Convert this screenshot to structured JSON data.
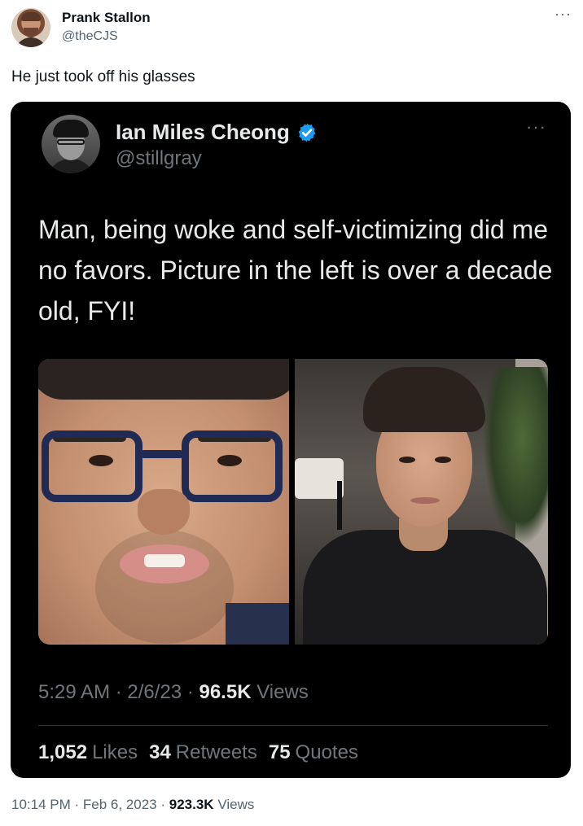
{
  "outer_tweet": {
    "author_name": "Prank Stallon",
    "author_handle": "@theCJS",
    "text": "He just took off his glasses",
    "time": "10:14 PM",
    "date": "Feb 6, 2023",
    "views_count": "923.3K",
    "views_label": "Views",
    "more_icon": "ellipsis-icon"
  },
  "quoted_tweet": {
    "author_name": "Ian Miles Cheong",
    "author_handle": "@stillgray",
    "verified_icon": "verified-badge-icon",
    "text": "Man, being woke and self-victimizing did me no favors. Picture in the left is over a decade old, FYI!",
    "time": "5:29 AM",
    "date": "2/6/23",
    "views_count": "96.5K",
    "views_label": "Views",
    "likes_count": "1,052",
    "likes_label": "Likes",
    "retweets_count": "34",
    "retweets_label": "Retweets",
    "quotes_count": "75",
    "quotes_label": "Quotes",
    "more_icon": "ellipsis-icon"
  },
  "colors": {
    "card_bg": "#000000",
    "verified_blue": "#1d9bf0",
    "muted_text": "#71767b",
    "outer_muted": "#536471"
  }
}
